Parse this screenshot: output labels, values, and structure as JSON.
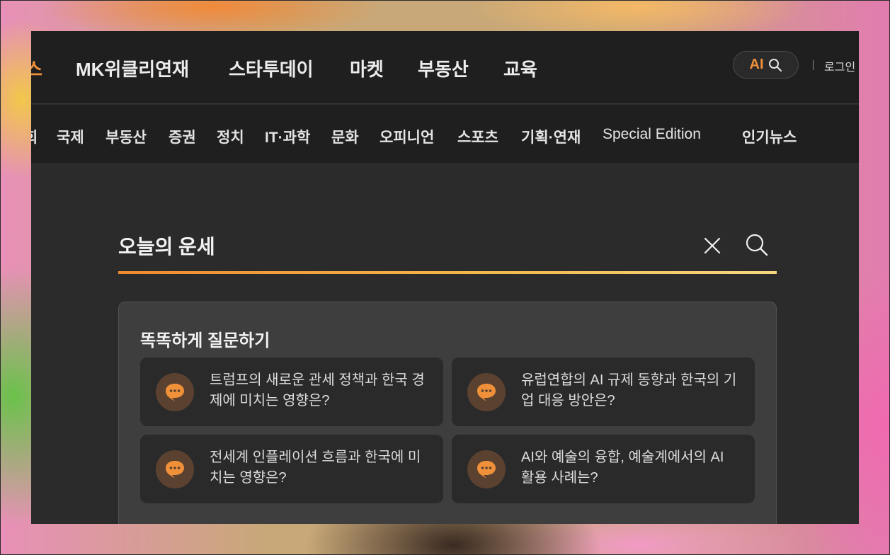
{
  "top_nav": {
    "partial_item": "스",
    "items": [
      "MK위클리연재",
      "스타투데이",
      "마켓",
      "부동산",
      "교육"
    ],
    "ai_button_label": "AI",
    "login_label": "로그인"
  },
  "sub_nav": {
    "partial_item": "회",
    "items": [
      "국제",
      "부동산",
      "증권",
      "정치",
      "IT·과학",
      "문화",
      "오피니언",
      "스포츠",
      "기획·연재",
      "Special Edition",
      "인기뉴스"
    ]
  },
  "search": {
    "value": "오늘의 운세"
  },
  "suggestions": {
    "title": "똑똑하게 질문하기",
    "cards": [
      {
        "text": "트럼프의 새로운 관세 정책과 한국 경제에 미치는 영향은?"
      },
      {
        "text": "유럽연합의 AI 규제 동향과 한국의 기업 대응 방안은?"
      },
      {
        "text": "전세계 인플레이션 흐름과 한국에 미치는 영향은?"
      },
      {
        "text": "AI와 예술의 융합, 예술계에서의 AI 활용 사례는?"
      }
    ]
  },
  "colors": {
    "accent": "#f0913a",
    "window_bg": "#2b2b2b",
    "nav_bg": "#1f1f1f",
    "panel_bg": "#3e3e3e",
    "card_bg": "#2a2a2a"
  }
}
